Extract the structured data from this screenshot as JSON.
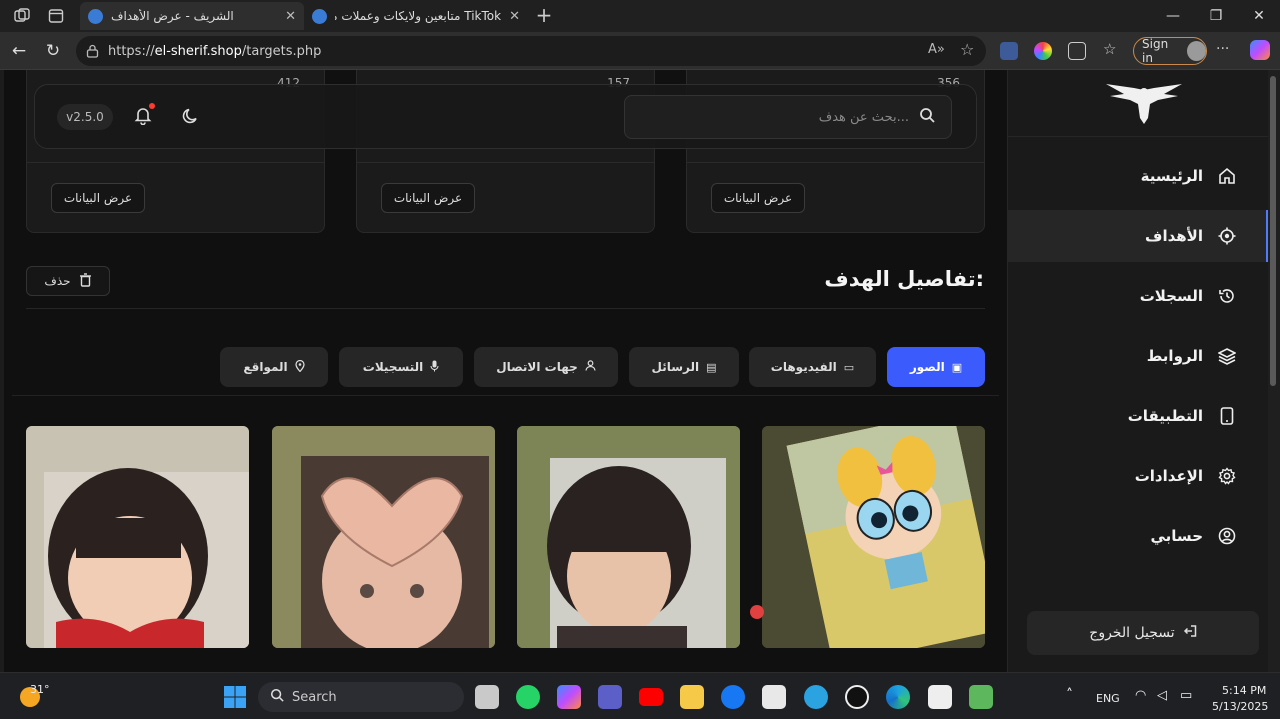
{
  "browser": {
    "tabs": [
      {
        "title": "الشريف - عرض الأهداف",
        "active": true
      },
      {
        "title": "TikTok متابعين ولايكات وعملات مجاناً",
        "active": false
      }
    ],
    "url_prefix": "https://",
    "url_host": "el-sherif.shop",
    "url_path": "/targets.php",
    "signin_label": "Sign in"
  },
  "cards": [
    {
      "count": "356",
      "button": "عرض البيانات"
    },
    {
      "count": "157",
      "button": "عرض البيانات"
    },
    {
      "count": "412",
      "button": "عرض البيانات"
    }
  ],
  "header": {
    "search_placeholder": "بحث عن هدف...",
    "version": "v2.5.0"
  },
  "sidebar": {
    "items": [
      {
        "label": "الرئيسية",
        "icon": "home-icon"
      },
      {
        "label": "الأهداف",
        "icon": "target-icon",
        "active": true
      },
      {
        "label": "السجلات",
        "icon": "history-icon"
      },
      {
        "label": "الروابط",
        "icon": "layers-icon"
      },
      {
        "label": "التطبيقات",
        "icon": "phone-icon"
      },
      {
        "label": "الإعدادات",
        "icon": "gear-icon"
      },
      {
        "label": "حسابي",
        "icon": "user-circle-icon"
      }
    ],
    "logout": "تسجيل الخروج"
  },
  "details": {
    "title": "تفاصيل الهدف:",
    "delete_label": "حذف",
    "tabs": [
      {
        "label": "الصور",
        "icon": "image-icon",
        "active": true
      },
      {
        "label": "الفيديوهات",
        "icon": "video-icon"
      },
      {
        "label": "الرسائل",
        "icon": "message-icon"
      },
      {
        "label": "جهات الاتصال",
        "icon": "user-icon"
      },
      {
        "label": "التسجيلات",
        "icon": "mic-icon"
      },
      {
        "label": "المواقع",
        "icon": "pin-icon"
      }
    ]
  },
  "taskbar": {
    "weather": "31°",
    "search": "Search",
    "lang": "ENG",
    "time": "5:14 PM",
    "date": "5/13/2025"
  },
  "colors": {
    "accent": "#3b5bfd",
    "active_border": "#4d7cfe",
    "signin_border": "#c98a4b"
  }
}
